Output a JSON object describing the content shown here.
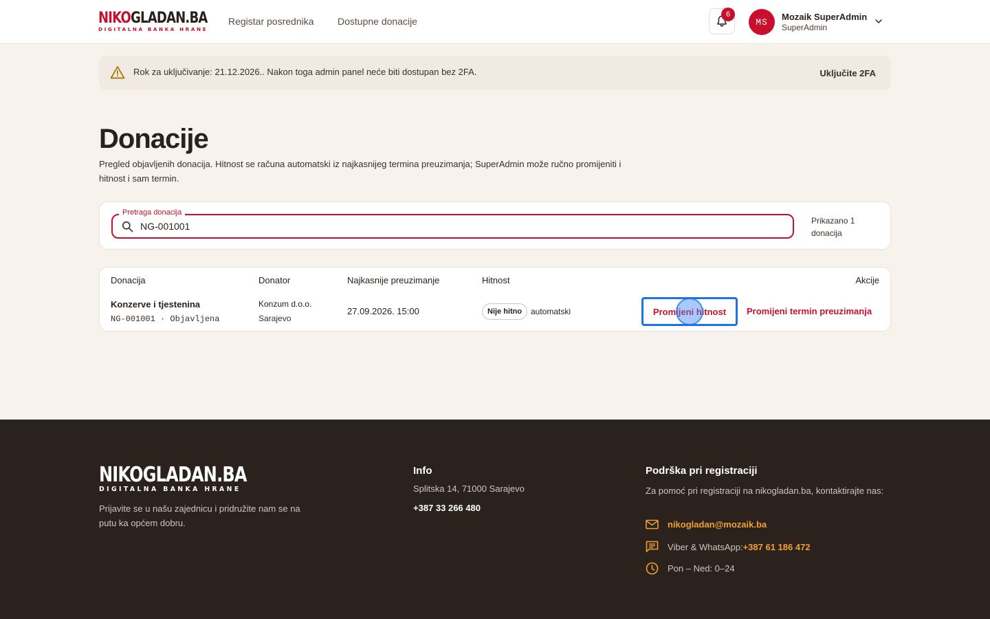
{
  "header": {
    "logo_main_1": "NIKO",
    "logo_main_2": "GLADAN.BA",
    "logo_sub": "DIGITALNA BANKA HRANE",
    "nav": [
      "Registar posrednika",
      "Dostupne donacije"
    ],
    "notifications_count": "6",
    "user": {
      "initials": "MS",
      "name": "Mozaik SuperAdmin",
      "role": "SuperAdmin"
    }
  },
  "alert": {
    "text": "Rok za uključivanje: 21.12.2026.. Nakon toga admin panel neće biti dostupan bez 2FA.",
    "action": "Uključite 2FA"
  },
  "page": {
    "title": "Donacije",
    "description": "Pregled objavljenih donacija. Hitnost se računa automatski iz najkasnijeg termina preuzimanja; SuperAdmin može ručno promijeniti i hitnost i sam termin."
  },
  "search": {
    "label": "Pretraga donacija",
    "value": "NG-001001",
    "count_text": "Prikazano 1 donacija"
  },
  "table": {
    "columns": [
      "Donacija",
      "Donator",
      "Najkasnije preuzimanje",
      "Hitnost",
      "Akcije"
    ],
    "rows": [
      {
        "title": "Konzerve i tjestenina",
        "code_status": "NG-001001 · Objavljena",
        "donor": "Konzum d.o.o.",
        "city": "Sarajevo",
        "pickup": "27.09.2026. 15:00",
        "urgency": "Nije hitno",
        "urgency_mode": "automatski",
        "action_urgency": "Promijeni hitnost",
        "action_pickup": "Promijeni termin preuzimanja"
      }
    ]
  },
  "footer": {
    "logo_main": "NIKOGLADAN.BA",
    "logo_sub": "DIGITALNA BANKA HRANE",
    "tagline": "Prijavite se u našu zajednicu i pridružite nam se na putu ka općem dobru.",
    "info_title": "Info",
    "address": "Splitska 14, 71000 Sarajevo",
    "phone": "+387 33 266 480",
    "support_title": "Podrška pri registraciji",
    "support_text": "Za pomoć pri registraciji na nikogladan.ba, kontaktirajte nas:",
    "email": "nikogladan@mozaik.ba",
    "viber_label": "Viber & WhatsApp: ",
    "viber_number": "+387 61 186 472",
    "hours": "Pon – Ned: 0–24"
  },
  "colors": {
    "brand": "#c8102e",
    "footer_bg": "#2b221d",
    "accent_orange": "#f0a030",
    "focus_blue": "#1a73e8"
  },
  "icons": [
    "bell-icon",
    "chevron-down-icon",
    "warning-icon",
    "search-icon",
    "mail-icon",
    "chat-icon",
    "clock-icon"
  ]
}
